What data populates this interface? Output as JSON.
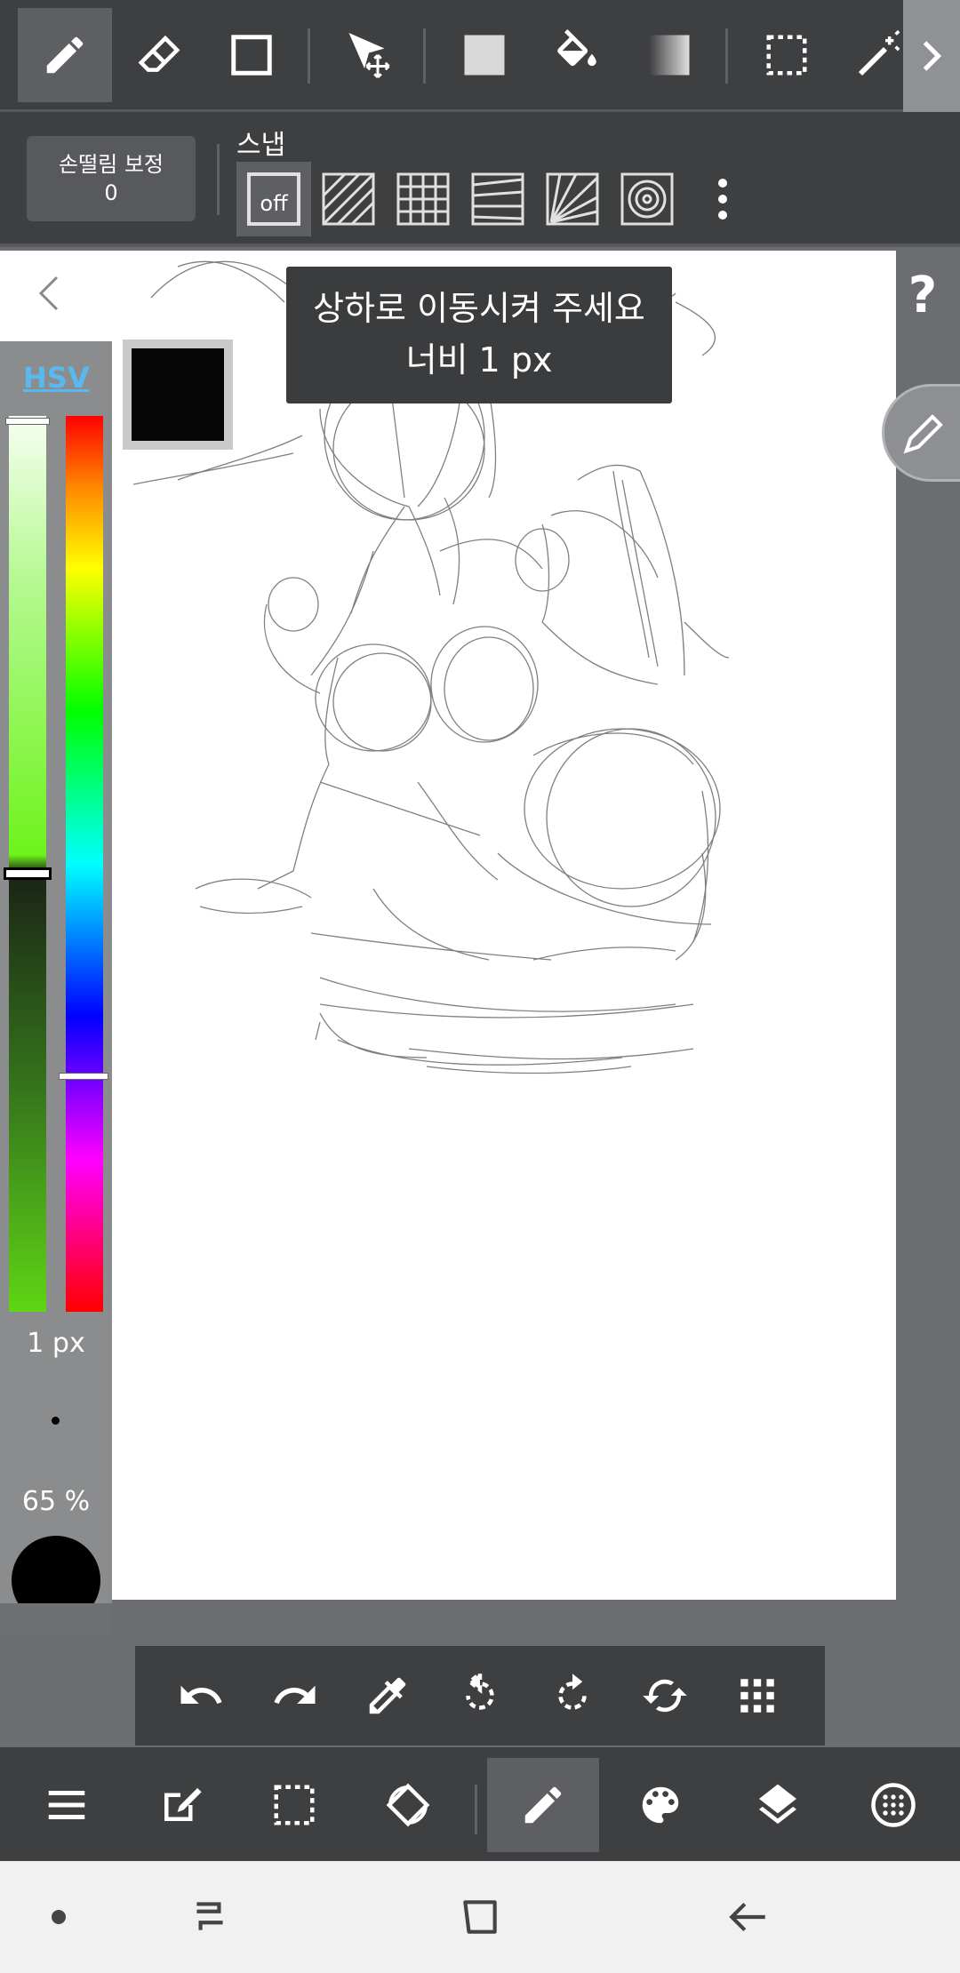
{
  "toolbar": {
    "tools": [
      {
        "name": "pen",
        "icon": "pencil-icon",
        "active": true
      },
      {
        "name": "eraser",
        "icon": "eraser-icon"
      },
      {
        "name": "shape",
        "icon": "square-outline-icon"
      },
      {
        "name": "move",
        "icon": "move-arrow-icon"
      },
      {
        "name": "fill-rect",
        "icon": "filled-square-icon"
      },
      {
        "name": "bucket",
        "icon": "paint-bucket-icon"
      },
      {
        "name": "gradient",
        "icon": "gradient-icon"
      },
      {
        "name": "select",
        "icon": "dotted-select-icon"
      },
      {
        "name": "magic-wand",
        "icon": "magic-wand-icon"
      }
    ],
    "more_icon": "chevron-right-icon"
  },
  "subbar": {
    "stabilizer_label": "손떨림 보정",
    "stabilizer_value": "0",
    "snap_label": "스냅",
    "snap_off_label": "off",
    "snap_icons": [
      "parallel-snap-icon",
      "grid-snap-icon",
      "perspective-snap-icon",
      "radial-snap-icon",
      "concentric-snap-icon"
    ],
    "more_icon": "vertical-dots-icon"
  },
  "tooltip": {
    "line1": "상하로 이동시켜 주세요",
    "line2": "너비 1 px"
  },
  "color_panel": {
    "mode": "HSV",
    "brush_size": "1 px",
    "opacity": "65 %",
    "current_color": "#060606"
  },
  "help": {
    "label": "?"
  },
  "action_bar": {
    "icons": [
      "undo-icon",
      "redo-icon",
      "eyedropper-icon",
      "rotate-left-icon",
      "rotate-right-icon",
      "flip-icon",
      "grid-dots-icon"
    ]
  },
  "bottom_bar": {
    "icons": [
      "menu-icon",
      "edit-icon",
      "selection-icon",
      "transform-icon",
      "brush-icon",
      "palette-icon",
      "layers-icon",
      "material-icon"
    ]
  },
  "system_nav": {
    "icons": [
      "dot-icon",
      "recent-apps-icon",
      "home-icon",
      "back-icon"
    ]
  },
  "colors": {
    "toolbar_bg": "#3e3f41",
    "active_bg": "#5e5f62",
    "panel_bg": "#8b8c8e",
    "accent": "#58b8ef"
  }
}
